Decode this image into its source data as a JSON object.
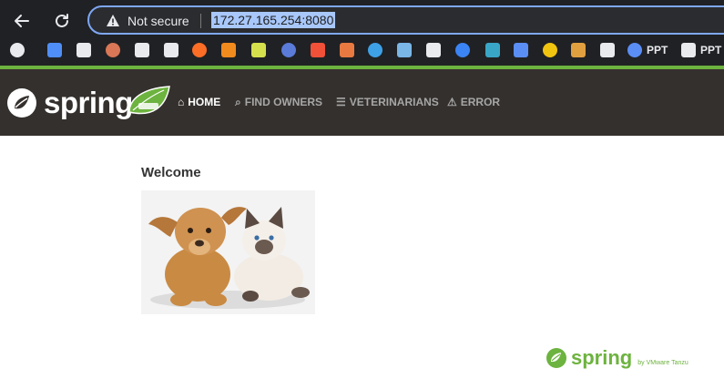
{
  "browser": {
    "not_secure": "Not secure",
    "url": "172.27.165.254:8080",
    "bookmarks": [
      {
        "icon": "tab-search-icon",
        "color": "#e8eaed"
      },
      {
        "icon": "gemini-icon",
        "color": "#4f8ef7"
      },
      {
        "icon": "openai-icon",
        "color": "#e8eaed"
      },
      {
        "icon": "claude-icon",
        "color": "#d97757"
      },
      {
        "icon": "perplexity-icon",
        "color": "#e8eaed"
      },
      {
        "icon": "github-icon",
        "color": "#e8eaed"
      },
      {
        "icon": "gitlab-icon",
        "color": "#fc6d26"
      },
      {
        "icon": "hex-icon",
        "color": "#f28b1e"
      },
      {
        "icon": "c-app-icon",
        "color": "#d6e04d"
      },
      {
        "icon": "sparkle-app-icon",
        "color": "#5a7bd8"
      },
      {
        "icon": "swift-icon",
        "color": "#f05138"
      },
      {
        "icon": "grid-app-icon",
        "color": "#e87a41"
      },
      {
        "icon": "circle-app-icon",
        "color": "#3ea1e6"
      },
      {
        "icon": "chart-app-icon",
        "color": "#7ab6e6"
      },
      {
        "icon": "podcast-icon",
        "color": "#e8eaed"
      },
      {
        "icon": "tune-icon",
        "color": "#3a84f5"
      },
      {
        "icon": "eye-icon",
        "color": "#3aa6c7"
      },
      {
        "icon": "flask-icon",
        "color": "#5a8ef5"
      },
      {
        "icon": "face-icon",
        "color": "#f1c40f"
      },
      {
        "icon": "candle-icon",
        "color": "#e0a040"
      },
      {
        "icon": "monitor-app-icon",
        "color": "#e8eaed"
      },
      {
        "icon": "ppt-circle-icon",
        "color": "#5a8ef5",
        "label": "PPT"
      },
      {
        "icon": "g-icon",
        "color": "#e8eaed",
        "label": "PPT"
      }
    ]
  },
  "app": {
    "logo_text": "spring",
    "menu": [
      {
        "label": "HOME",
        "icon": "home-icon",
        "active": true
      },
      {
        "label": "FIND OWNERS",
        "icon": "search-icon",
        "active": false
      },
      {
        "label": "VETERINARIANS",
        "icon": "list-icon",
        "active": false
      },
      {
        "label": "ERROR",
        "icon": "warning-icon",
        "active": false
      }
    ],
    "welcome": "Welcome",
    "footer": {
      "brand": "spring",
      "by": "by VMware Tanzu"
    },
    "colors": {
      "navbar": "#34302d",
      "accent": "#6db33f"
    }
  }
}
